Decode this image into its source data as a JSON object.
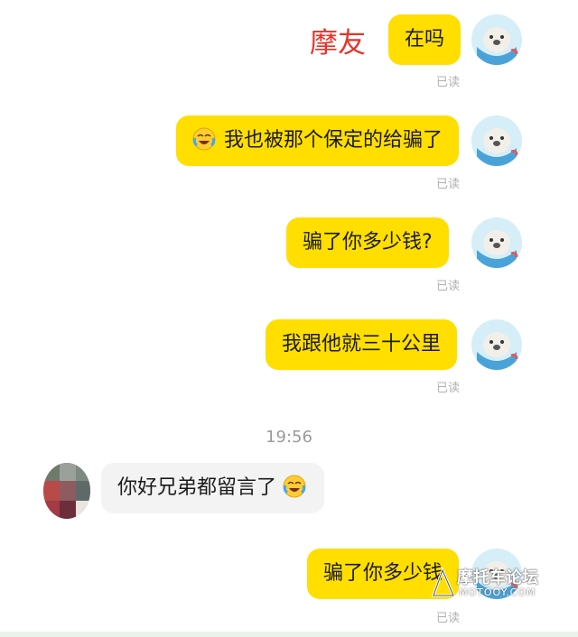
{
  "overlay_label": "摩友",
  "messages_out": [
    {
      "text": "在吗",
      "status": "已读"
    },
    {
      "text": "我也被那个保定的给骗了",
      "status": "已读",
      "emoji": "crying-laughing-emoji"
    },
    {
      "text": "骗了你多少钱?",
      "status": "已读"
    },
    {
      "text": "我跟他就三十公里",
      "status": "已读"
    }
  ],
  "timestamp": "19:56",
  "message_in": {
    "text": "你好兄弟都留言了",
    "emoji": "crying-laughing-emoji"
  },
  "message_out_last": {
    "text": "骗了你多少钱",
    "status": "已读"
  },
  "watermark": {
    "text": "摩托车论坛",
    "sub": "MOTOOY.COM"
  },
  "colors": {
    "outgoing_bubble": "#ffde00",
    "incoming_bubble": "#f3f3f3",
    "overlay_label": "#e8322a"
  }
}
